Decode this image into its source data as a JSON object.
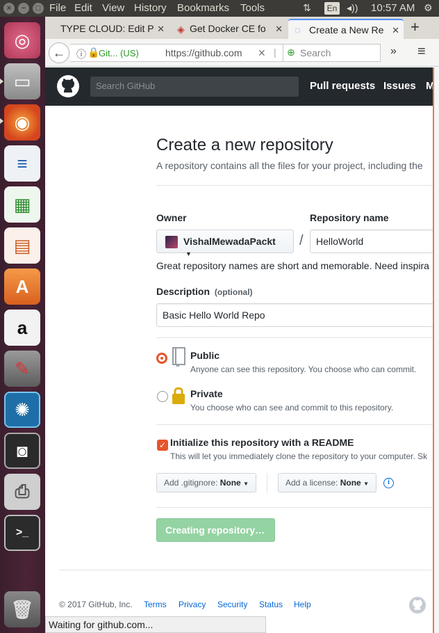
{
  "panel": {
    "menu": [
      "File",
      "Edit",
      "View",
      "History",
      "Bookmarks",
      "Tools"
    ],
    "keyboard": "En",
    "time": "10:57 AM"
  },
  "tabs": [
    {
      "title": "TYPE CLOUD: Edit P"
    },
    {
      "title": "Get Docker CE fo"
    },
    {
      "title": "Create a New Re"
    }
  ],
  "address_bar": {
    "site_identity": "Git... (US)",
    "url": "https://github.com",
    "search_placeholder": "Search"
  },
  "github": {
    "search_placeholder": "Search GitHub",
    "nav": [
      "Pull requests",
      "Issues",
      "M"
    ]
  },
  "page": {
    "title": "Create a new repository",
    "subtitle": "A repository contains all the files for your project, including the",
    "owner_label": "Owner",
    "owner_value": "VishalMewadaPackt",
    "separator": "/",
    "repo_label": "Repository name",
    "repo_value": "HelloWorld",
    "hint": "Great repository names are short and memorable. Need inspira",
    "description_label": "Description",
    "optional": "(optional)",
    "description_value": "Basic Hello World Repo",
    "public_title": "Public",
    "public_desc": "Anyone can see this repository. You choose who can commit.",
    "private_title": "Private",
    "private_desc": "You choose who can see and commit to this repository.",
    "readme_title": "Initialize this repository with a README",
    "readme_desc": "This will let you immediately clone the repository to your computer. Sk",
    "gitignore_label": "Add .gitignore:",
    "gitignore_value": "None",
    "license_label": "Add a license:",
    "license_value": "None",
    "create_button": "Creating repository…"
  },
  "footer": {
    "copyright": "© 2017 GitHub, Inc.",
    "links": [
      "Terms",
      "Privacy",
      "Security",
      "Status",
      "Help"
    ]
  },
  "status_bar": "Waiting for github.com...",
  "colors": {
    "accent": "#e7552c",
    "github_dark": "#24292e",
    "link": "#0366d6",
    "create_button": "#94d3a2"
  }
}
